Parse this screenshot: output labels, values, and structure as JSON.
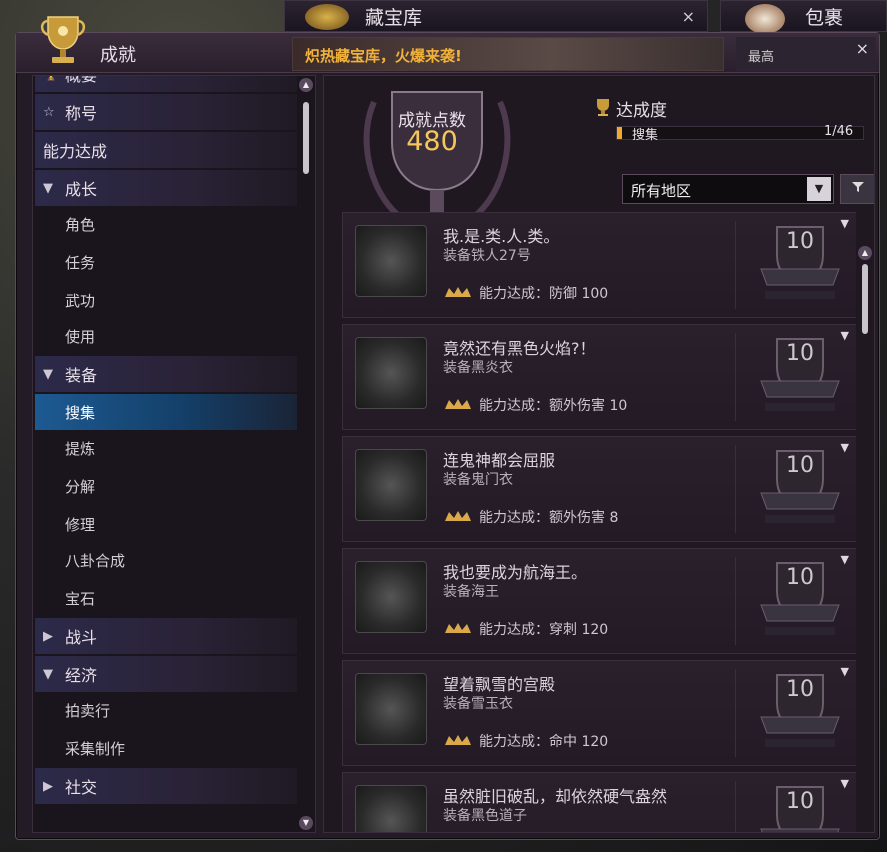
{
  "top_tabs": {
    "treasure": {
      "label": "藏宝库",
      "close": "×"
    },
    "bag": {
      "label": "包裹"
    }
  },
  "window": {
    "title": "成就",
    "banner": "炽热藏宝库，火爆来袭!",
    "banner_right": "最高",
    "close": "×"
  },
  "sidebar": {
    "items": [
      {
        "label": "概要",
        "type": "cat",
        "glyph": "🏆"
      },
      {
        "label": "称号",
        "type": "cat",
        "glyph": "☆"
      },
      {
        "label": "能力达成",
        "type": "cat",
        "glyph": ""
      },
      {
        "label": "成长",
        "type": "cat",
        "glyph": "▼"
      },
      {
        "label": "角色",
        "type": "sub"
      },
      {
        "label": "任务",
        "type": "sub"
      },
      {
        "label": "武功",
        "type": "sub"
      },
      {
        "label": "使用",
        "type": "sub"
      },
      {
        "label": "装备",
        "type": "cat",
        "glyph": "▼"
      },
      {
        "label": "搜集",
        "type": "sub",
        "selected": true
      },
      {
        "label": "提炼",
        "type": "sub"
      },
      {
        "label": "分解",
        "type": "sub"
      },
      {
        "label": "修理",
        "type": "sub"
      },
      {
        "label": "八卦合成",
        "type": "sub"
      },
      {
        "label": "宝石",
        "type": "sub"
      },
      {
        "label": "战斗",
        "type": "cat",
        "glyph": "▶"
      },
      {
        "label": "经济",
        "type": "cat",
        "glyph": "▼"
      },
      {
        "label": "拍卖行",
        "type": "sub"
      },
      {
        "label": "采集制作",
        "type": "sub"
      },
      {
        "label": "社交",
        "type": "cat",
        "glyph": "▶"
      }
    ]
  },
  "summary": {
    "score_label": "成就点数",
    "score_value": "480",
    "progress_title": "达成度",
    "progress_name": "搜集",
    "progress_count": "1/46",
    "progress_fraction": 0.0217
  },
  "filters": {
    "region": "所有地区",
    "region_arrow": "▼",
    "filter_icon": "funnel-icon"
  },
  "achievements": [
    {
      "title": "我.是.类.人.类。",
      "desc": "装备铁人27号",
      "reward": "能力达成：防御 100",
      "points": "10"
    },
    {
      "title": "竟然还有黑色火焰?！",
      "desc": "装备黑炎衣",
      "reward": "能力达成：额外伤害 10",
      "points": "10"
    },
    {
      "title": "连鬼神都会屈服",
      "desc": "装备鬼门衣",
      "reward": "能力达成：额外伤害 8",
      "points": "10"
    },
    {
      "title": "我也要成为航海王。",
      "desc": "装备海王",
      "reward": "能力达成：穿刺 120",
      "points": "10"
    },
    {
      "title": "望着飘雪的宫殿",
      "desc": "装备雪玉衣",
      "reward": "能力达成：命中 120",
      "points": "10"
    },
    {
      "title": "虽然脏旧破乱，却依然硬气盎然",
      "desc": "装备黑色道子",
      "reward": "",
      "points": "10"
    }
  ],
  "colors": {
    "accent_gold": "#f3c75c",
    "selected_blue": "#1d5a92",
    "progress_orange": "#f0a830"
  }
}
